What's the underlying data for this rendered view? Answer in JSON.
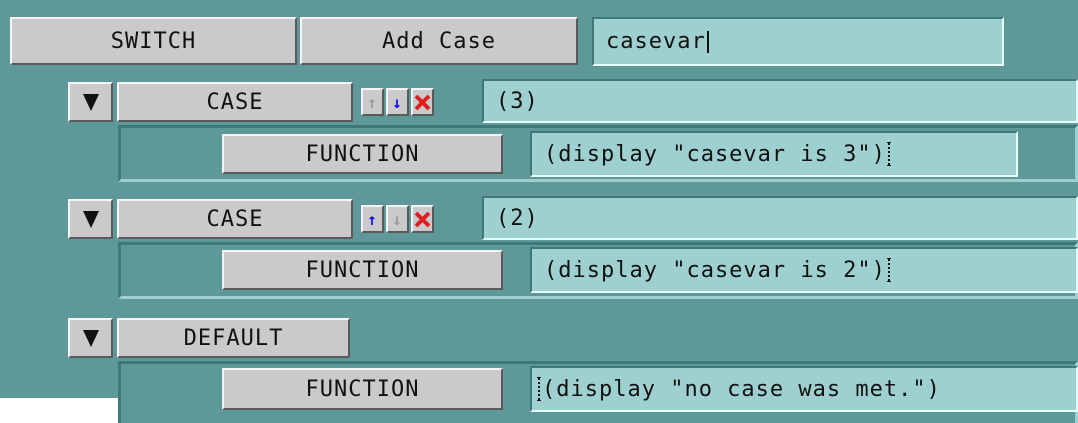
{
  "header": {
    "switch_label": "SWITCH",
    "add_case_label": "Add Case",
    "variable_value": "casevar"
  },
  "rows": [
    {
      "kind_label": "CASE",
      "value": "(3)",
      "function_label": "FUNCTION",
      "function_body": "(display \"casevar is 3\")",
      "up_enabled": false,
      "down_enabled": true
    },
    {
      "kind_label": "CASE",
      "value": "(2)",
      "function_label": "FUNCTION",
      "function_body": "(display \"casevar is 2\")",
      "up_enabled": true,
      "down_enabled": false
    },
    {
      "kind_label": "DEFAULT",
      "function_label": "FUNCTION",
      "function_body": "(display \"no case was met.\")"
    }
  ],
  "icons": {
    "collapse": "triangle-down-icon",
    "move_up": "arrow-up-icon",
    "move_down": "arrow-down-icon",
    "delete": "red-x-icon"
  },
  "colors": {
    "panel_bg": "#5f9898",
    "field_bg": "#9fd0d0",
    "button_bg": "#cacaca",
    "delete_red": "#e02020",
    "arrow_blue": "#1010ee"
  }
}
